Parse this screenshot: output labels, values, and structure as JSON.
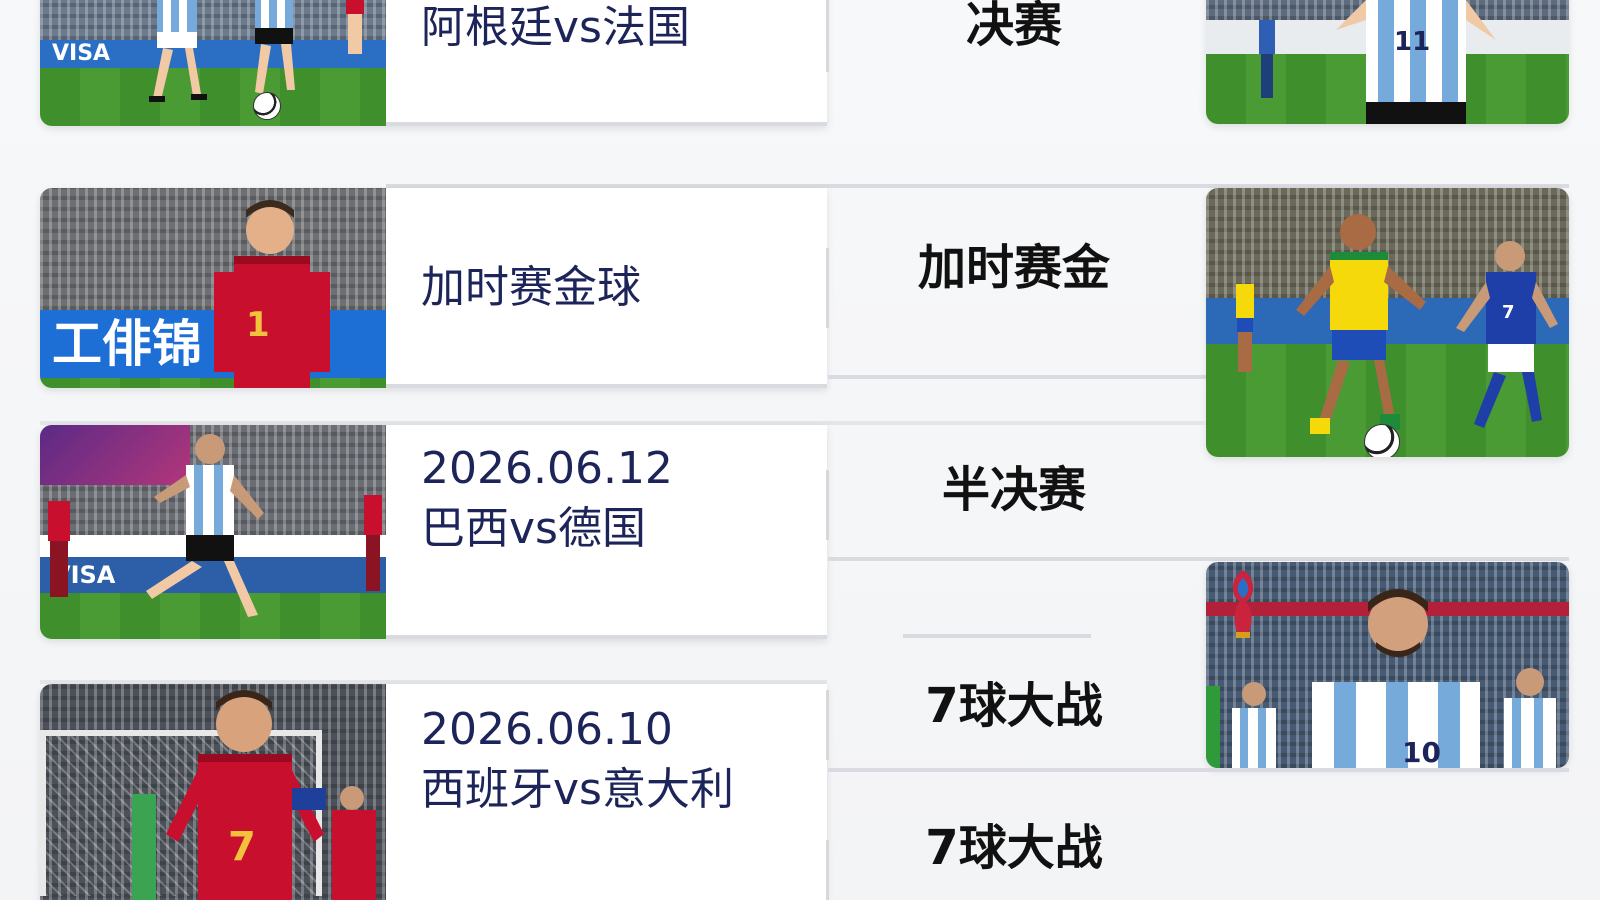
{
  "rows": [
    {
      "lines": [
        "阿根廷vs法国"
      ],
      "stage": "决赛",
      "thumb_board_text": "VISA"
    },
    {
      "lines": [
        "加时赛金球"
      ],
      "stage": "加时赛金",
      "thumb_board_text": "工俳锦"
    },
    {
      "lines": [
        "2026.06.12",
        "巴西vs德国"
      ],
      "stage": "半决赛",
      "thumb_board_text": "VISA"
    },
    {
      "lines": [
        "2026.06.10",
        "西班牙vs意大利"
      ],
      "stage": "7球大战",
      "thumb_board_text": ""
    }
  ],
  "extra_stage_label": "7球大战",
  "jersey_numbers": {
    "right_top_player": "11",
    "left_row2_player": "1",
    "left_row4_player": "7",
    "right_mid_player": "7",
    "right_bottom_player": "10"
  },
  "icons": {
    "trophy": "world-cup-trophy-icon",
    "ball": "football-icon"
  },
  "colors": {
    "title_text": "#1c2459",
    "stage_text": "#111111",
    "divider": "#d9dbe0",
    "argentina_blue": "#75aadb",
    "spain_red": "#c8102e",
    "brazil_yellow": "#f5d90a",
    "pitch_green": "#4a9b34"
  }
}
